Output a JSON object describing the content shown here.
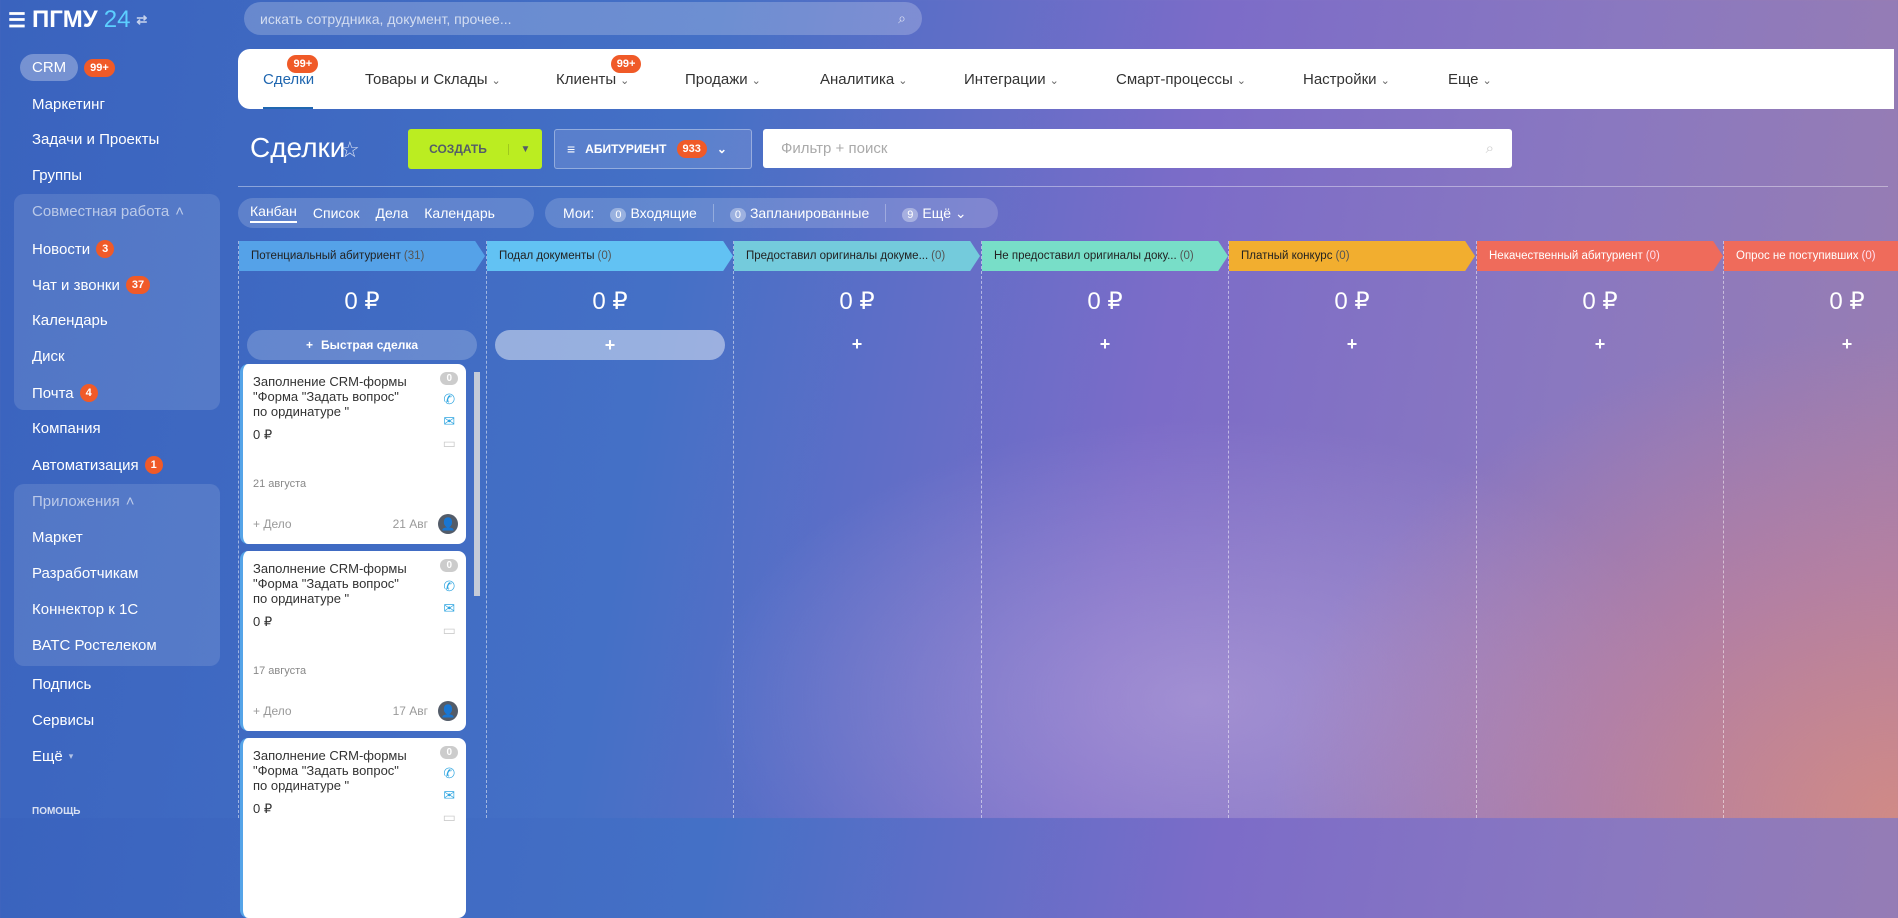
{
  "app": {
    "menu_icon": "hamburger-icon",
    "logo_text": "ПГМУ",
    "logo_num": "24",
    "search_placeholder": "искать сотрудника, документ, прочее..."
  },
  "sidebar": {
    "crm": {
      "label": "CRM",
      "badge": "99+"
    },
    "items_top": [
      "Маркетинг",
      "Задачи и Проекты",
      "Группы"
    ],
    "group1": {
      "title": "Совместная работа",
      "items": [
        {
          "label": "Новости",
          "badge": "3"
        },
        {
          "label": "Чат и звонки",
          "badge": "37"
        },
        {
          "label": "Календарь"
        },
        {
          "label": "Диск"
        },
        {
          "label": "Почта",
          "badge": "4"
        }
      ]
    },
    "items_mid": [
      {
        "label": "Компания"
      },
      {
        "label": "Автоматизация",
        "badge": "1"
      }
    ],
    "group2": {
      "title": "Приложения",
      "items": [
        "Маркет",
        "Разработчикам",
        "Коннектор к 1С",
        "ВАТС Ростелеком"
      ]
    },
    "items_bottom": [
      "Подпись",
      "Сервисы",
      "Ещё"
    ],
    "help": "ПОМОЩЬ"
  },
  "nav": [
    {
      "label": "Сделки",
      "badge": "99+",
      "active": true
    },
    {
      "label": "Товары и Склады"
    },
    {
      "label": "Клиенты",
      "badge": "99+"
    },
    {
      "label": "Продажи"
    },
    {
      "label": "Аналитика"
    },
    {
      "label": "Интеграции"
    },
    {
      "label": "Смарт-процессы"
    },
    {
      "label": "Настройки"
    },
    {
      "label": "Еще"
    }
  ],
  "toolbar": {
    "title": "Сделки",
    "create": "СОЗДАТЬ",
    "filter_label": "АБИТУРИЕНТ",
    "filter_count": "933",
    "search_placeholder": "Фильтр + поиск"
  },
  "views": [
    "Канбан",
    "Список",
    "Дела",
    "Календарь"
  ],
  "my": {
    "label": "Мои:",
    "incoming_count": "0",
    "incoming": "Входящие",
    "planned_count": "0",
    "planned": "Запланированные",
    "more_count": "9",
    "more": "Ещё"
  },
  "columns": [
    {
      "title": "Потенциальный абитуриент",
      "count": "(31)",
      "sum": "0 ₽",
      "color": "#55a2e8"
    },
    {
      "title": "Подал документы",
      "count": "(0)",
      "sum": "0 ₽",
      "color": "#62c2f3"
    },
    {
      "title": "Предоставил оригиналы докуме...",
      "count": "(0)",
      "sum": "0 ₽",
      "color": "#74cbdc"
    },
    {
      "title": "Не предоставил оригиналы доку...",
      "count": "(0)",
      "sum": "0 ₽",
      "color": "#78dec8"
    },
    {
      "title": "Платный конкурс",
      "count": "(0)",
      "sum": "0 ₽",
      "color": "#f2ae2f"
    },
    {
      "title": "Некачественный абитуриент",
      "count": "(0)",
      "sum": "0 ₽",
      "color": "#ef6b5b"
    },
    {
      "title": "Опрос не поступивших",
      "count": "(0)",
      "sum": "0 ₽",
      "color": "#ef6b5b"
    }
  ],
  "quick_deal": "Быстрая сделка",
  "plus": "+",
  "cards": [
    {
      "title": "Заполнение CRM-формы \"Форма \"Задать вопрос\" по ординатуре \"",
      "price": "0 ₽",
      "date": "21 августа",
      "add": "+ Дело",
      "short_date": "21 Авг",
      "count": "0"
    },
    {
      "title": "Заполнение CRM-формы \"Форма \"Задать вопрос\" по ординатуре \"",
      "price": "0 ₽",
      "date": "17 августа",
      "add": "+ Дело",
      "short_date": "17 Авг",
      "count": "0"
    },
    {
      "title": "Заполнение CRM-формы \"Форма \"Задать вопрос\" по ординатуре \"",
      "price": "0 ₽",
      "count": "0"
    }
  ]
}
